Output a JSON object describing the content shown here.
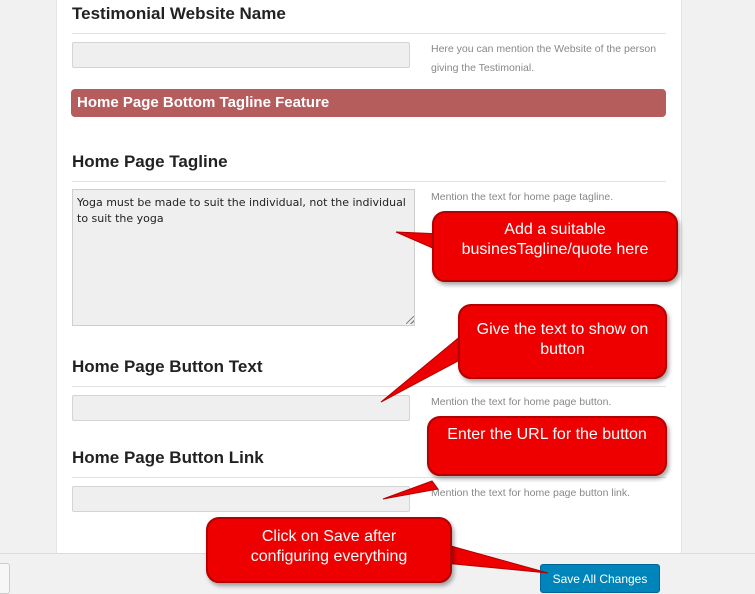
{
  "form": {
    "testimonial_website": {
      "heading": "Testimonial Website Name",
      "value": "",
      "description": "Here you can mention the Website of the person giving the Testimonial."
    },
    "section_title": "Home Page Bottom Tagline Feature",
    "tagline": {
      "heading": "Home Page Tagline",
      "value": "Yoga must be made to suit the individual, not the individual to suit the yoga",
      "description": "Mention the text for home page tagline."
    },
    "button_text": {
      "heading": "Home Page Button Text",
      "value": "",
      "description": "Mention the text for home page button."
    },
    "button_link": {
      "heading": "Home Page Button Link",
      "value": "",
      "description": "Mention the text for home page button link."
    },
    "save_label": "Save All Changes"
  },
  "callouts": {
    "tagline": "Add a suitable businesTagline/quote here",
    "button_text": "Give the text to show on button",
    "button_link": "Enter the URL for the button",
    "save": "Click on Save after configuring everything"
  },
  "colors": {
    "section_bar": "#b55c5c",
    "callout": "#ee0000",
    "save_button": "#0085ba"
  }
}
